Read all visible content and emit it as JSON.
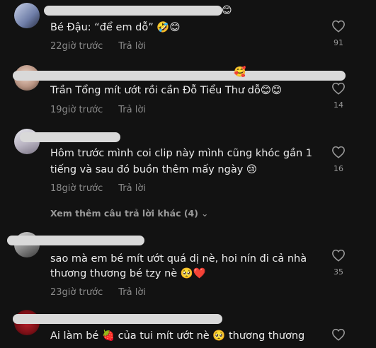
{
  "comments": [
    {
      "text": "Bé Đậu: “để em dỗ” 🤣😊",
      "time": "22giờ trước",
      "reply": "Trả lời",
      "likes": "91",
      "name_emoji": "😊"
    },
    {
      "text": "Trần Tổng mít ướt rồi cần Đỗ Tiểu Thư dỗ😊😊",
      "time": "19giờ trước",
      "reply": "Trả lời",
      "likes": "14",
      "name_emoji": "🥰"
    },
    {
      "text_line1": "Hôm trước mình coi clip này mình cũng khóc gần 1",
      "text_line2": "tiếng và sau đó buồn thêm mấy ngày 😢",
      "time": "18giờ trước",
      "reply": "Trả lời",
      "likes": "16",
      "more_replies": "Xem thêm câu trả lời khác (4)"
    },
    {
      "text_line1": "sao mà em bé mít ướt quá dị nè, hoi nín đi cả nhà",
      "text_line2": "thương thương bé tzy nè 🥺❤️",
      "time": "23giờ trước",
      "reply": "Trả lời",
      "likes": "35"
    },
    {
      "text": "Ai làm bé 🍓 của tui mít ướt nè 🥺 thương thương"
    }
  ],
  "icons": {
    "like": "heart-outline-icon",
    "expand": "chevron-down-icon"
  },
  "colors": {
    "background": "#121212",
    "text": "#ececec",
    "secondary": "#8a8a8a"
  }
}
